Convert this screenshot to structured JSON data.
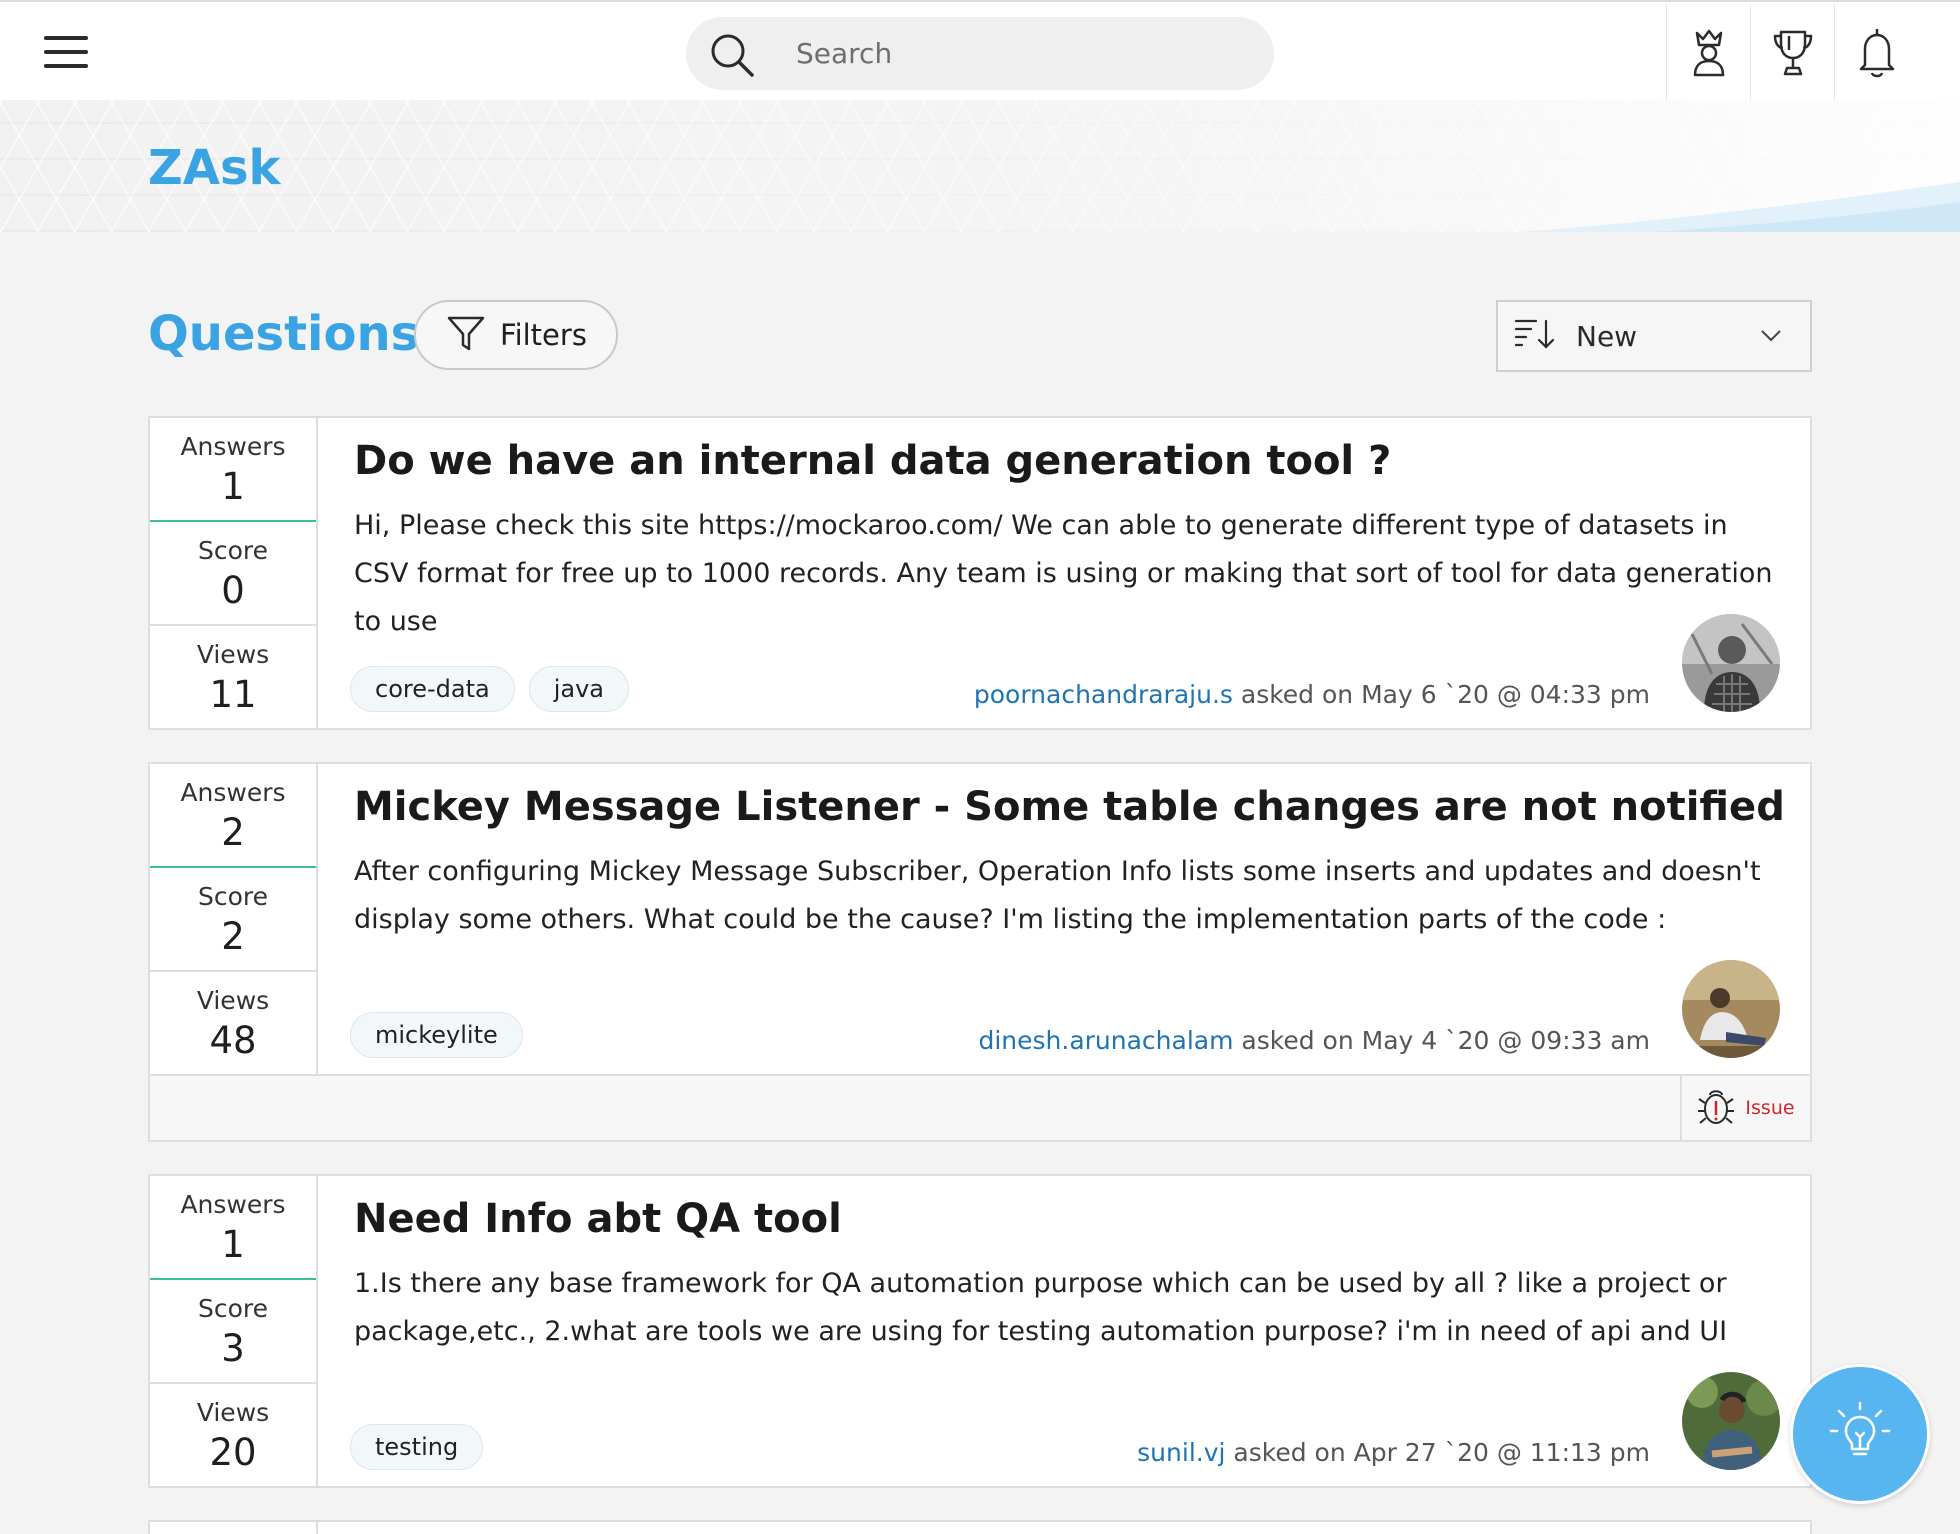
{
  "header": {
    "menu_icon": "hamburger-menu-icon",
    "search": {
      "placeholder": "Search",
      "value": ""
    },
    "icons": [
      "leaderboard-icon",
      "trophy-icon",
      "notification-bell-icon"
    ]
  },
  "banner": {
    "app_title": "ZAsk"
  },
  "toolbar": {
    "heading": "Questions",
    "filters_label": "Filters",
    "sort": {
      "selected": "New"
    }
  },
  "questions": [
    {
      "stats": {
        "answers_label": "Answers",
        "answers": "1",
        "score_label": "Score",
        "score": "0",
        "views_label": "Views",
        "views": "11"
      },
      "title": "Do we have an internal data generation tool ?",
      "body": "Hi, Please check this site https://mockaroo.com/ We can able to generate different type of datasets in CSV format for free up to 1000 records. Any team is using or making that sort of tool for data generation to use",
      "tags": [
        "core-data",
        "java"
      ],
      "user": "poornachandraraju.s",
      "asked": " asked on May 6 `20 @ 04:33 pm"
    },
    {
      "stats": {
        "answers_label": "Answers",
        "answers": "2",
        "score_label": "Score",
        "score": "2",
        "views_label": "Views",
        "views": "48"
      },
      "title": "Mickey Message Listener - Some table changes are not notified",
      "body": "After configuring Mickey Message Subscriber, Operation Info lists some inserts and updates and doesn't display some others. What could be the cause? I'm listing the implementation parts of the code :",
      "tags": [
        "mickeylite"
      ],
      "user": "dinesh.arunachalam",
      "asked": " asked on May 4 `20 @ 09:33 am",
      "type_label": "Issue"
    },
    {
      "stats": {
        "answers_label": "Answers",
        "answers": "1",
        "score_label": "Score",
        "score": "3",
        "views_label": "Views",
        "views": "20"
      },
      "title": "Need Info abt QA tool",
      "body": "1.Is there any base framework for QA automation purpose which can be used by all ? like a project or package,etc., 2.what are tools we are using for testing automation purpose? i'm in need of api and UI",
      "tags": [
        "testing"
      ],
      "user": "sunil.vj",
      "asked": " asked on Apr 27 `20 @ 11:13 pm"
    }
  ],
  "fab": {
    "icon": "ask-question-lightbulb-icon"
  },
  "colors": {
    "accent": "#3aa3e3",
    "link": "#1f74b2",
    "answers_bar": "#3fbf8f",
    "issue": "#d4242a",
    "fab": "#57b5ef"
  }
}
